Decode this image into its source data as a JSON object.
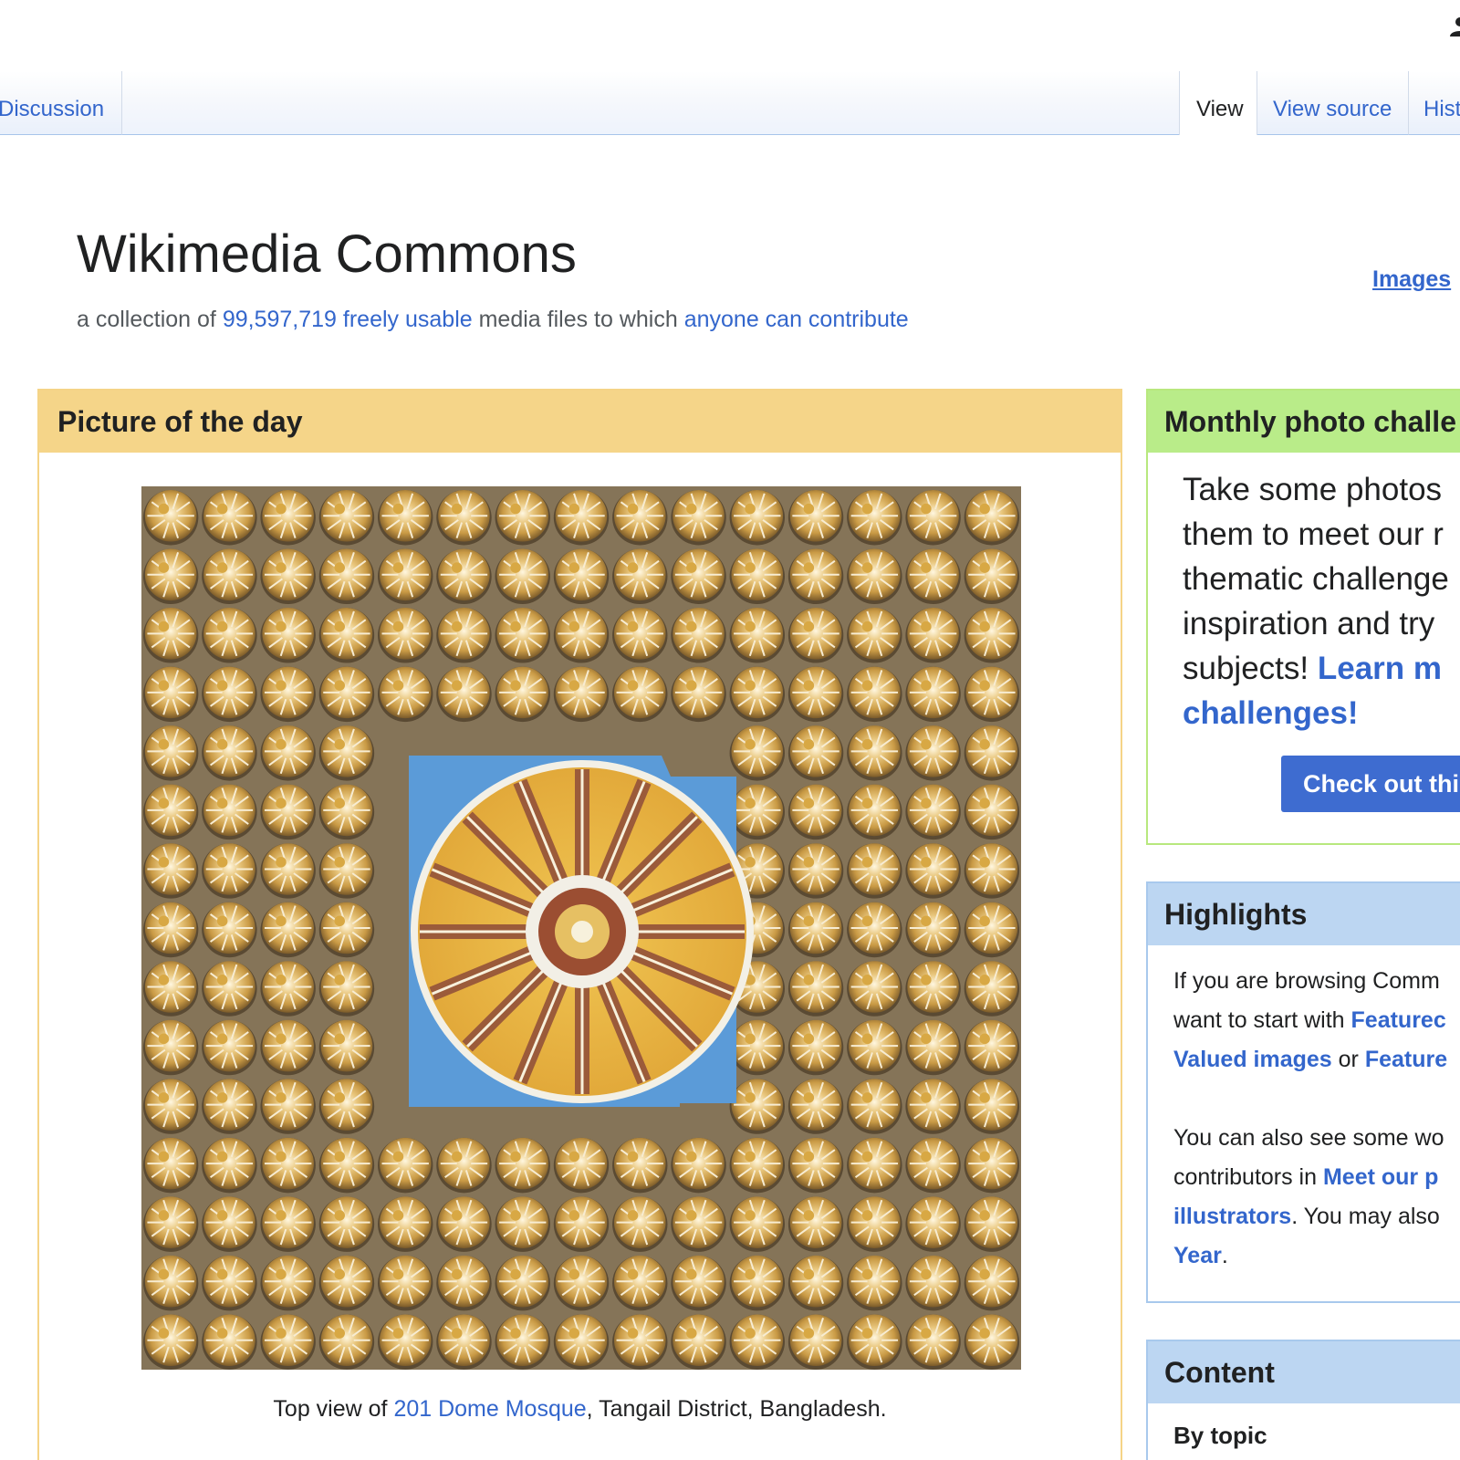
{
  "tabs": {
    "discussion": "Discussion",
    "view": "View",
    "view_source": "View source",
    "history": "Hist"
  },
  "header": {
    "title": "Wikimedia Commons",
    "sub_prefix": "a collection of ",
    "count": "99,597,719",
    "freely_usable": "freely usable",
    "sub_middle": " media files to which ",
    "anyone": "anyone can contribute",
    "images_link": "Images"
  },
  "potd": {
    "heading": "Picture of the day",
    "caption_prefix": "Top view of ",
    "caption_link": "201 Dome Mosque",
    "caption_suffix": ", Tangail District, Bangladesh."
  },
  "challenge": {
    "heading": "Monthly photo challe",
    "line1": "Take some photos",
    "line2": "them to meet our r",
    "line3": "thematic challenge",
    "line4": "inspiration and try",
    "line5_prefix": "subjects! ",
    "line5_link": "Learn m",
    "line6_link": "challenges!",
    "button": "Check out thi"
  },
  "highlights": {
    "heading": "Highlights",
    "l1": "If you are browsing Comm",
    "l2_prefix": "want to start with ",
    "l2_link": "Featurec",
    "l3_link": "Valued images",
    "l3_mid": " or ",
    "l3_link2": "Feature",
    "l4": "You can also see some wo",
    "l5_prefix": "contributors in ",
    "l5_link": "Meet our p",
    "l6_link": "illustrators",
    "l6_suffix": ". You may also",
    "l7_link": "Year",
    "l7_suffix": "."
  },
  "content": {
    "heading": "Content",
    "by_topic": "By topic"
  },
  "colors": {
    "link": "#3366cc",
    "potd_header": "#f5d589",
    "challenge_header": "#b9ec89",
    "blue_header": "#bcd6f2",
    "button": "#3e6cd0"
  },
  "icons": [
    "user-icon"
  ]
}
